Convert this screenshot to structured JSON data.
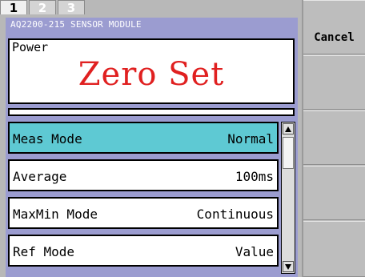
{
  "tabs": [
    {
      "label": "1",
      "active": true
    },
    {
      "label": "2",
      "active": false
    },
    {
      "label": "3",
      "active": false
    }
  ],
  "module": {
    "title": "AQ2200-215 SENSOR MODULE"
  },
  "display": {
    "label": "Power",
    "value": "Zero Set",
    "value_color": "#e02020"
  },
  "settings": {
    "rows": [
      {
        "label": "Meas Mode",
        "value": "Normal",
        "selected": true
      },
      {
        "label": "Average",
        "value": "100ms",
        "selected": false
      },
      {
        "label": "MaxMin Mode",
        "value": "Continuous",
        "selected": false
      },
      {
        "label": "Ref Mode",
        "value": "Value",
        "selected": false
      }
    ]
  },
  "softkeys": [
    {
      "label": "Cancel"
    },
    {
      "label": ""
    },
    {
      "label": ""
    },
    {
      "label": ""
    },
    {
      "label": ""
    }
  ],
  "colors": {
    "panel": "#9b9cd0",
    "selected_row": "#5ec9d3",
    "value_text": "#e02020"
  },
  "icons": {
    "scroll_up": "triangle-up",
    "scroll_down": "triangle-down"
  }
}
